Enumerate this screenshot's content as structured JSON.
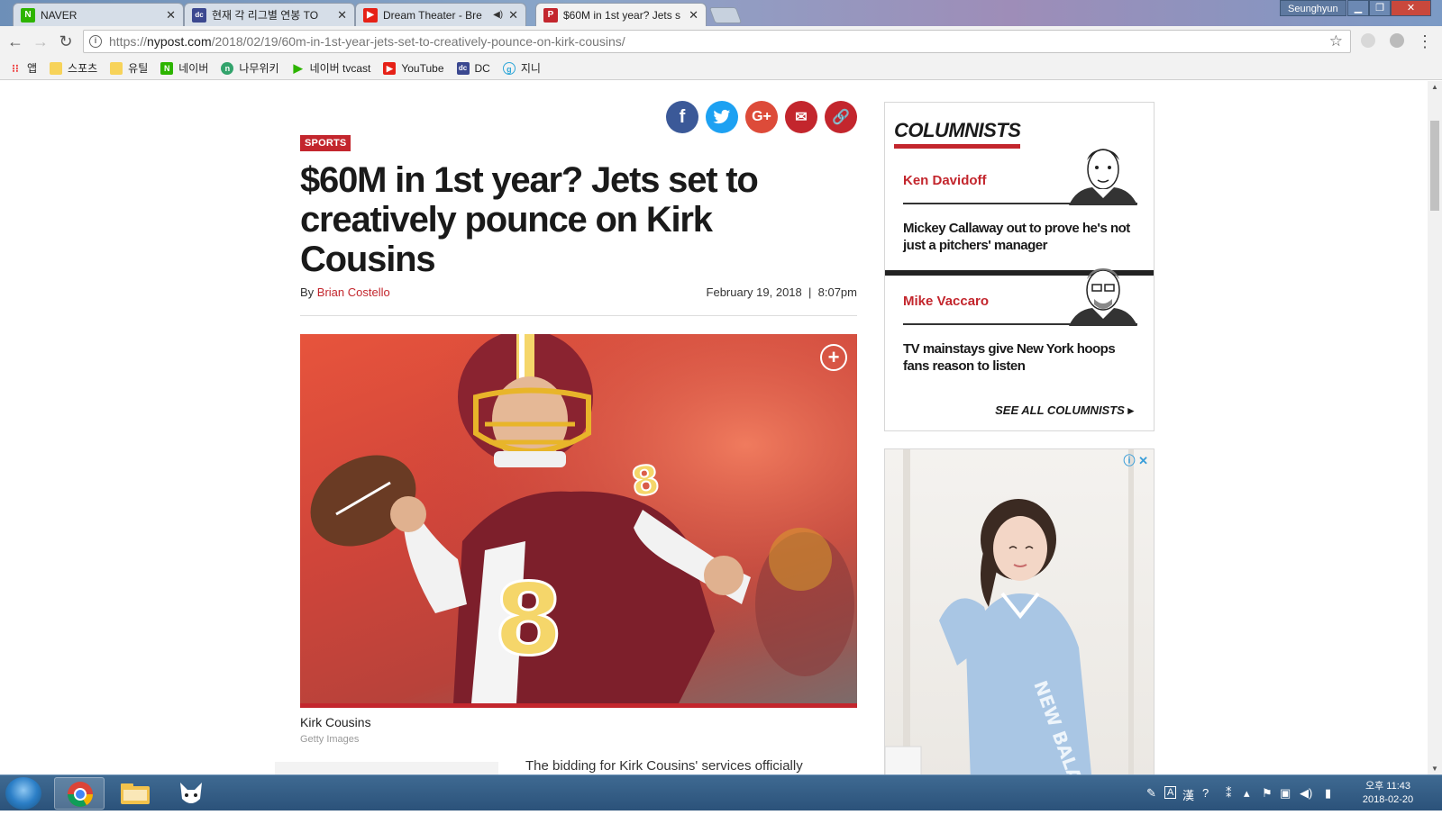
{
  "browser": {
    "tabs": [
      {
        "title": "NAVER",
        "favicon": "naver-icon"
      },
      {
        "title": "현재 각 리그별 연봉 TO",
        "favicon": "dc-icon"
      },
      {
        "title": "Dream Theater - Bre",
        "favicon": "youtube-icon"
      },
      {
        "title": "$60M in 1st year? Jets s",
        "favicon": "nypost-icon"
      }
    ],
    "user": "Seunghyun",
    "url_prefix": "https://",
    "url_domain": "nypost.com",
    "url_path": "/2018/02/19/60m-in-1st-year-jets-set-to-creatively-pounce-on-kirk-cousins/",
    "bookmarks": [
      {
        "label": "앱",
        "icon": "apps-grid-icon"
      },
      {
        "label": "스포츠",
        "icon": "folder-icon"
      },
      {
        "label": "유틸",
        "icon": "folder-icon"
      },
      {
        "label": "네이버",
        "icon": "naver-icon"
      },
      {
        "label": "나무위키",
        "icon": "namuwiki-icon"
      },
      {
        "label": "네이버 tvcast",
        "icon": "tvcast-icon"
      },
      {
        "label": "YouTube",
        "icon": "youtube-icon"
      },
      {
        "label": "DC",
        "icon": "dc-icon"
      },
      {
        "label": "지니",
        "icon": "genie-icon"
      }
    ]
  },
  "article": {
    "category": "SPORTS",
    "headline": "$60M in 1st year? Jets set to creatively pounce on Kirk Cousins",
    "byline_prefix": "By",
    "author": "Brian Costello",
    "date": "February 19, 2018",
    "separator": "|",
    "time": "8:07pm",
    "caption": "Kirk Cousins",
    "credit": "Getty Images",
    "body_start": "The bidding for Kirk Cousins' services officially",
    "share_icons": [
      "facebook-icon",
      "twitter-icon",
      "google-plus-icon",
      "email-icon",
      "link-icon"
    ]
  },
  "columnists": {
    "title": "COLUMNISTS",
    "items": [
      {
        "name": "Ken Davidoff",
        "story": "Mickey Callaway out to prove he's not just a pitchers' manager"
      },
      {
        "name": "Mike Vaccaro",
        "story": "TV mainstays give New York hoops fans reason to listen"
      }
    ],
    "see_all": "SEE ALL COLUMNISTS"
  },
  "ad": {
    "icons": "ⓘ ✕"
  },
  "taskbar": {
    "time": "오후 11:43",
    "date": "2018-02-20"
  },
  "colors": {
    "nypost_red": "#c3262d",
    "facebook": "#3b5998",
    "twitter": "#1da1f2",
    "google_plus": "#dd4b39",
    "email": "#c3262d",
    "link": "#c3262d"
  }
}
